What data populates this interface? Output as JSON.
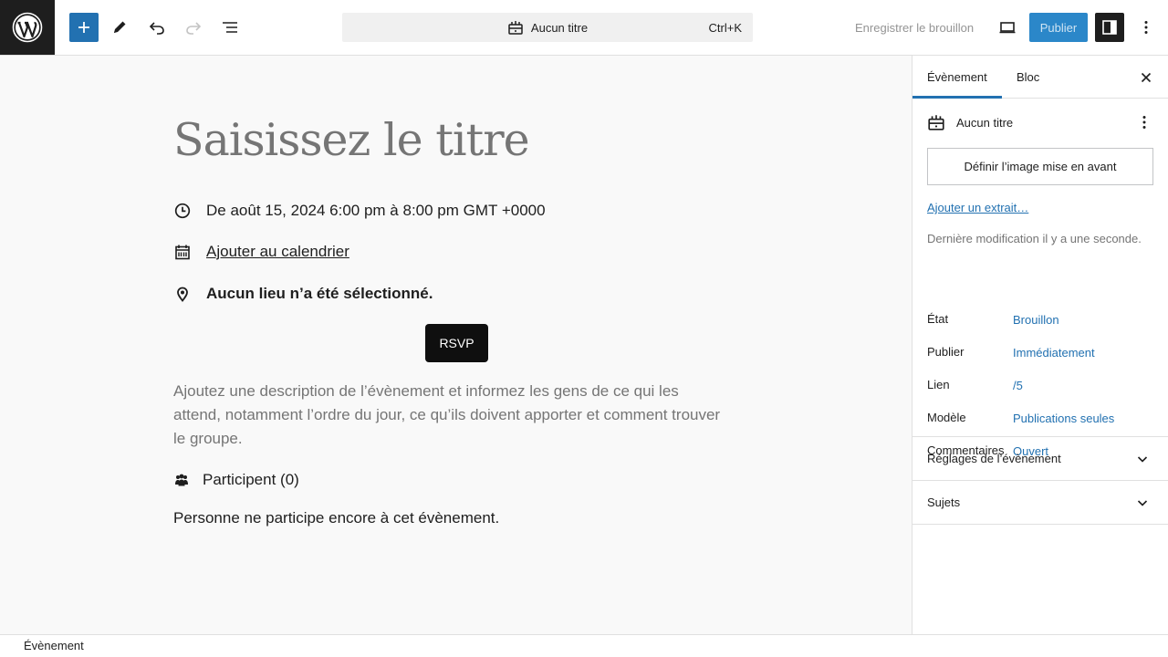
{
  "header": {
    "logo": "wordpress-logo",
    "command_bar": {
      "title": "Aucun titre",
      "shortcut": "Ctrl+K"
    },
    "save_draft": "Enregistrer le brouillon",
    "publish": "Publier"
  },
  "editor": {
    "title_placeholder": "Saisissez le titre",
    "datetime": "De août 15, 2024 6:00 pm à 8:00 pm GMT +0000",
    "calendar_link": "Ajouter au calendrier",
    "venue": "Aucun lieu n’a été sélectionné.",
    "rsvp": "RSVP",
    "description_placeholder": "Ajoutez une description de l’évènement et informez les gens de ce qui les attend, notamment l’ordre du jour, ce qu’ils doivent apporter et comment trouver le groupe.",
    "attendees_title": "Participent (0)",
    "no_attendees": "Personne ne participe encore à cet évènement."
  },
  "sidebar": {
    "tabs": [
      "Évènement",
      "Bloc"
    ],
    "doc_title": "Aucun titre",
    "featured_image": "Définir l’image mise en avant",
    "excerpt": "Ajouter un extrait…",
    "last_modified": "Dernière modification il y a une seconde.",
    "summary": [
      {
        "label": "État",
        "value": "Brouillon"
      },
      {
        "label": "Publier",
        "value": "Immédiatement"
      },
      {
        "label": "Lien",
        "value": "/5"
      },
      {
        "label": "Modèle",
        "value": "Publications seules"
      },
      {
        "label": "Commentaires",
        "value": "Ouvert"
      }
    ],
    "panels": [
      "Réglages de l’évènement",
      "Sujets"
    ]
  },
  "footer": {
    "breadcrumb": "Évènement"
  }
}
